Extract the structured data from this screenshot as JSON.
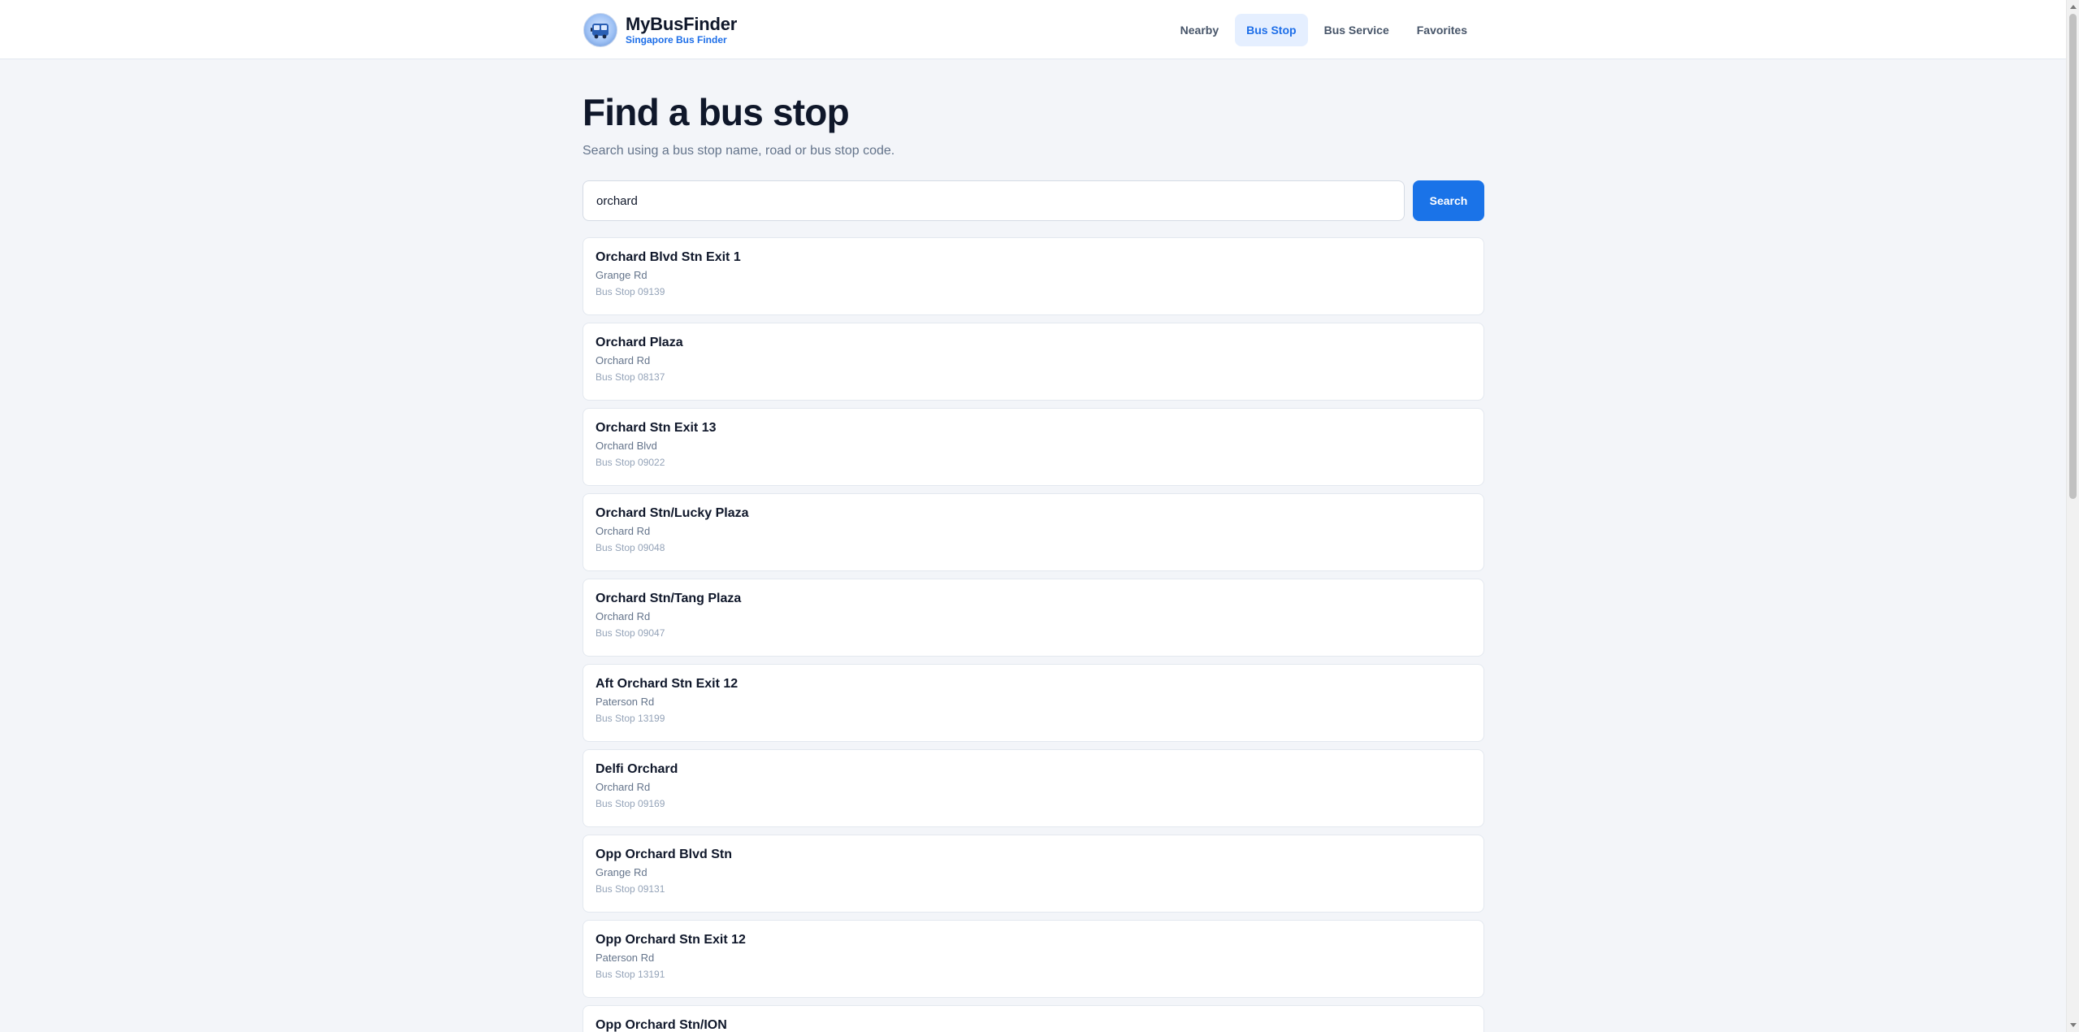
{
  "app": {
    "name": "MyBusFinder",
    "tagline": "Singapore Bus Finder",
    "logo_icon": "bus-logo-icon"
  },
  "nav": {
    "items": [
      {
        "label": "Nearby",
        "active": false
      },
      {
        "label": "Bus Stop",
        "active": true
      },
      {
        "label": "Bus Service",
        "active": false
      },
      {
        "label": "Favorites",
        "active": false
      }
    ]
  },
  "page": {
    "title": "Find a bus stop",
    "subtitle": "Search using a bus stop name, road or bus stop code."
  },
  "search": {
    "value": "orchard",
    "button_label": "Search"
  },
  "results": [
    {
      "name": "Orchard Blvd Stn Exit 1",
      "road": "Grange Rd",
      "code": "Bus Stop 09139"
    },
    {
      "name": "Orchard Plaza",
      "road": "Orchard Rd",
      "code": "Bus Stop 08137"
    },
    {
      "name": "Orchard Stn Exit 13",
      "road": "Orchard Blvd",
      "code": "Bus Stop 09022"
    },
    {
      "name": "Orchard Stn/Lucky Plaza",
      "road": "Orchard Rd",
      "code": "Bus Stop 09048"
    },
    {
      "name": "Orchard Stn/Tang Plaza",
      "road": "Orchard Rd",
      "code": "Bus Stop 09047"
    },
    {
      "name": "Aft Orchard Stn Exit 12",
      "road": "Paterson Rd",
      "code": "Bus Stop 13199"
    },
    {
      "name": "Delfi Orchard",
      "road": "Orchard Rd",
      "code": "Bus Stop 09169"
    },
    {
      "name": "Opp Orchard Blvd Stn",
      "road": "Grange Rd",
      "code": "Bus Stop 09131"
    },
    {
      "name": "Opp Orchard Stn Exit 12",
      "road": "Paterson Rd",
      "code": "Bus Stop 13191"
    },
    {
      "name": "Opp Orchard Stn/ION",
      "road": "",
      "code": ""
    }
  ],
  "colors": {
    "accent": "#1a73e8",
    "background": "#f3f5f9",
    "nav_active_bg": "#e5efff"
  }
}
